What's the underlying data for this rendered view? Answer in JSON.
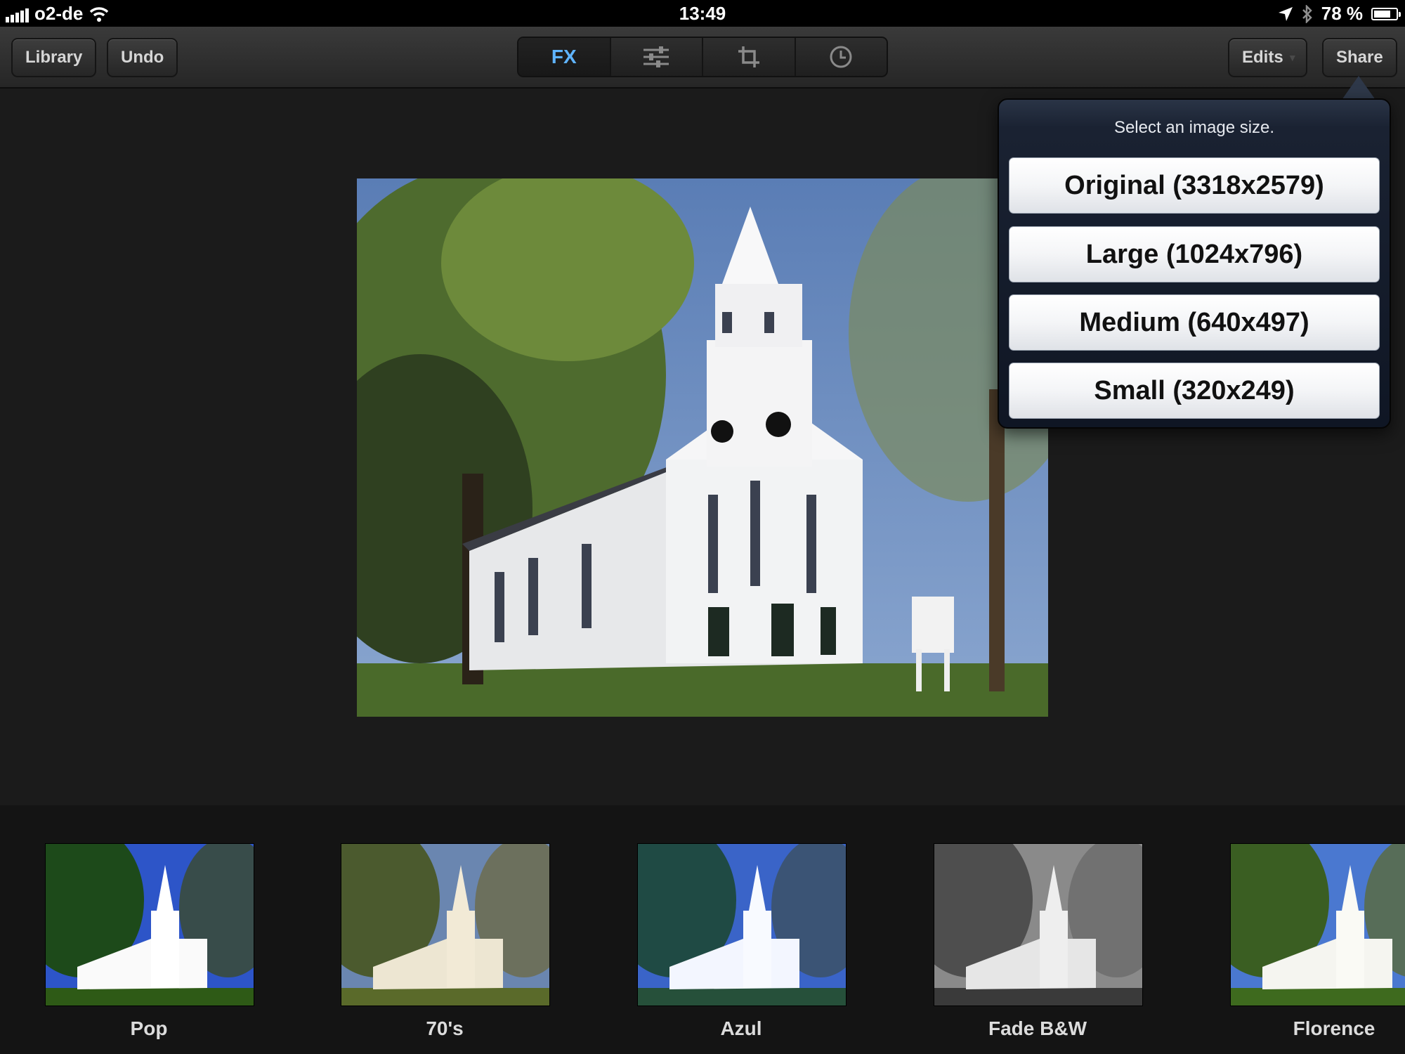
{
  "status": {
    "carrier": "o2-de",
    "time": "13:49",
    "battery": "78 %",
    "battery_level": 0.78
  },
  "toolbar": {
    "library_label": "Library",
    "undo_label": "Undo",
    "tabs": [
      {
        "label": "FX",
        "icon": "fx",
        "active": true
      },
      {
        "label": "",
        "icon": "sliders-icon",
        "active": false
      },
      {
        "label": "",
        "icon": "crop-icon",
        "active": false
      },
      {
        "label": "",
        "icon": "clock-icon",
        "active": false
      }
    ],
    "edits_label": "Edits",
    "share_label": "Share"
  },
  "share_popover": {
    "title": "Select an image size.",
    "options": [
      "Original (3318x2579)",
      "Large (1024x796)",
      "Medium (640x497)",
      "Small (320x249)"
    ]
  },
  "filters": [
    {
      "label": "Pop"
    },
    {
      "label": "70's"
    },
    {
      "label": "Azul"
    },
    {
      "label": "Fade B&W"
    },
    {
      "label": "Florence"
    }
  ],
  "colors": {
    "accent": "#5fb4ff",
    "popover_bg": "#1a2232"
  }
}
